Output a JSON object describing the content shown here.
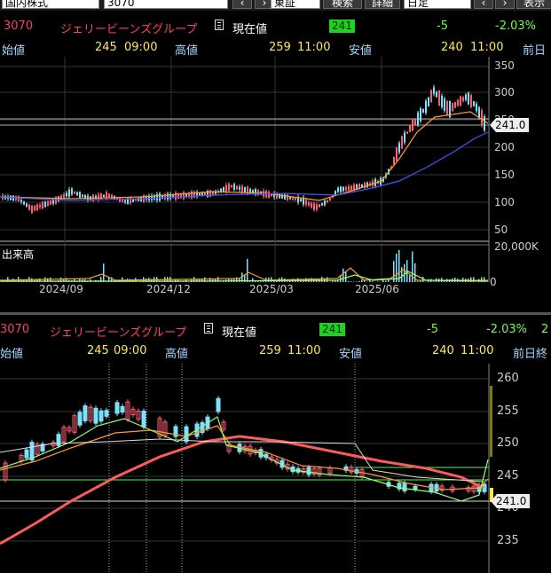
{
  "toolbar": {
    "market_select": "国内株式",
    "code_input": "3070",
    "exchange_select": "東証",
    "search_button": "検索",
    "detail_button": "詳細",
    "period_select": "日足",
    "display_button": "表示",
    "prev_icon": "chevron-left-icon",
    "next_icon": "chevron-right-icon"
  },
  "chart1": {
    "code": "3070",
    "name": "ジェリービーンズグループ",
    "current_label": "現在値",
    "current_value": "241",
    "change": "-5",
    "change_pct": "-2.03%",
    "open_label": "始値",
    "open_value": "245",
    "open_time": "09:00",
    "high_label": "高値",
    "high_value": "259",
    "high_time": "11:00",
    "low_label": "安値",
    "low_value": "240",
    "low_time": "11:00",
    "prev_label": "前日",
    "price_tag": "241.0",
    "y_ticks": [
      "350",
      "300",
      "250",
      "200",
      "150",
      "100",
      "50"
    ],
    "volume_label": "出来高",
    "volume_ticks": [
      "20,000K",
      "0"
    ],
    "x_ticks": [
      "2024/09",
      "2024/12",
      "2025/03",
      "2025/06"
    ]
  },
  "chart2": {
    "code": "3070",
    "name": "ジェリービーンズグループ",
    "current_label": "現在値",
    "current_value": "241",
    "change": "-5",
    "change_pct": "-2.03%",
    "extra": "2",
    "open_label": "始値",
    "open_value": "245",
    "open_time": "09:00",
    "high_label": "高値",
    "high_value": "259",
    "high_time": "11:00",
    "low_label": "安値",
    "low_value": "240",
    "low_time": "11:00",
    "prev_label": "前日終",
    "price_tag": "241.0",
    "y_ticks": [
      "260",
      "255",
      "250",
      "245",
      "240",
      "235"
    ]
  },
  "colors": {
    "accent_pink": "#ff3a6e",
    "price_green": "#1fd11f",
    "label_yellow": "#ffe84a",
    "label_cyan": "#9fd8ff",
    "ma_red": "#ff5a5a",
    "ma_blue": "#3a5aff",
    "ma_orange": "#ff9a2a",
    "ma_green": "#9aff6a"
  }
}
